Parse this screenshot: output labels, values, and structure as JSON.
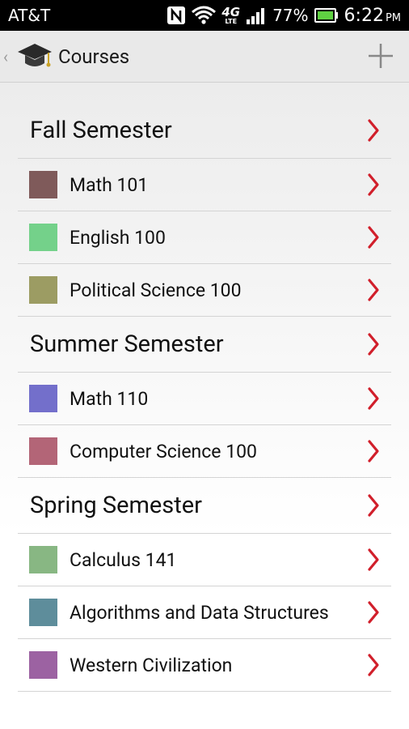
{
  "status_bar": {
    "carrier": "AT&T",
    "network": "4G",
    "network_sub": "LTE",
    "battery_percent": "77%",
    "time": "6:22",
    "ampm": "PM",
    "icons": [
      "nfc-icon",
      "wifi-icon",
      "lte-icon",
      "signal-icon",
      "battery-icon"
    ]
  },
  "action_bar": {
    "title": "Courses",
    "app_icon": "graduation-cap-icon",
    "add_icon": "plus-icon"
  },
  "colors": {
    "chevron": "#d11f2b",
    "divider": "#d4d4d4"
  },
  "semesters": [
    {
      "name": "Fall Semester",
      "courses": [
        {
          "name": "Math 101",
          "color": "#7f5a5a"
        },
        {
          "name": "English 100",
          "color": "#74d18a"
        },
        {
          "name": "Political Science 100",
          "color": "#9c9c63"
        }
      ]
    },
    {
      "name": "Summer Semester",
      "courses": [
        {
          "name": "Math 110",
          "color": "#736fcb"
        },
        {
          "name": "Computer Science 100",
          "color": "#b36577"
        }
      ]
    },
    {
      "name": "Spring Semester",
      "courses": [
        {
          "name": "Calculus 141",
          "color": "#88b783"
        },
        {
          "name": "Algorithms and Data Structures",
          "color": "#5e8d9b"
        },
        {
          "name": "Western Civilization",
          "color": "#9c62a2"
        }
      ]
    }
  ]
}
